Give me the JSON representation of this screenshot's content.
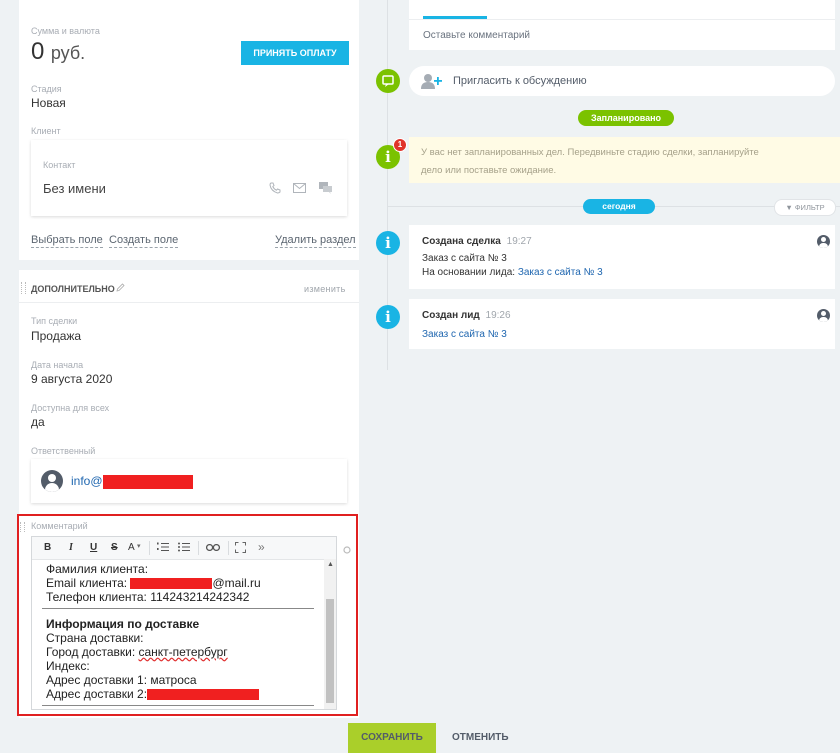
{
  "deal": {
    "amount_label": "Сумма и валюта",
    "amount_value": "0",
    "currency": "руб.",
    "accept_payment": "ПРИНЯТЬ ОПЛАТУ",
    "stage_label": "Стадия",
    "stage_value": "Новая",
    "client_label": "Клиент",
    "contact_label": "Контакт",
    "contact_value": "Без имени",
    "select_field": "Выбрать поле",
    "create_field": "Создать поле",
    "delete_section": "Удалить раздел"
  },
  "additional": {
    "title": "ДОПОЛНИТЕЛЬНО",
    "edit": "изменить",
    "deal_type_label": "Тип сделки",
    "deal_type_value": "Продажа",
    "start_date_label": "Дата начала",
    "start_date_value": "9 августа 2020",
    "available_label": "Доступна для всех",
    "available_value": "да",
    "responsible_label": "Ответственный",
    "responsible_value": "info@"
  },
  "comment": {
    "label": "Комментарий",
    "toolbar": [
      "B",
      "I",
      "U",
      "S",
      "A",
      "»"
    ],
    "lines": {
      "l1": "Фамилия клиента:",
      "l2_prefix": "Email клиента: ",
      "l2_suffix": "@mail.ru",
      "l3": "Телефон клиента: 114243214242342",
      "heading": "Информация по доставке",
      "l5": "Страна доставки:",
      "l6_prefix": "Город доставки: ",
      "l6_city": "санкт-петербург",
      "l7": "Индекс:",
      "l8": "Адрес доставки 1: матроса",
      "l9": "Адрес доставки 2:"
    }
  },
  "footer": {
    "save": "СОХРАНИТЬ",
    "cancel": "ОТМЕНИТЬ"
  },
  "timeline": {
    "comment_placeholder": "Оставьте комментарий",
    "invite": "Пригласить к обсуждению",
    "planned_badge": "Запланировано",
    "no_tasks_line1": "У вас нет запланированных дел. Передвиньте стадию сделки, запланируйте",
    "no_tasks_line2": "дело или поставьте ожидание.",
    "notification_count": "1",
    "today_badge": "сегодня",
    "filter": "ФИЛЬТР",
    "events": [
      {
        "title": "Создана сделка",
        "time": "19:27",
        "line1": "Заказ с сайта № 3",
        "line2_prefix": "На основании лида: ",
        "line2_link": "Заказ с сайта № 3"
      },
      {
        "title": "Создан лид",
        "time": "19:26",
        "link": "Заказ с сайта № 3"
      }
    ]
  },
  "colors": {
    "accent_blue": "#19b4e4",
    "green": "#7bc200",
    "save_green": "#aacf2a",
    "highlight_red": "#e02020",
    "note_bg": "#fffbe5"
  }
}
